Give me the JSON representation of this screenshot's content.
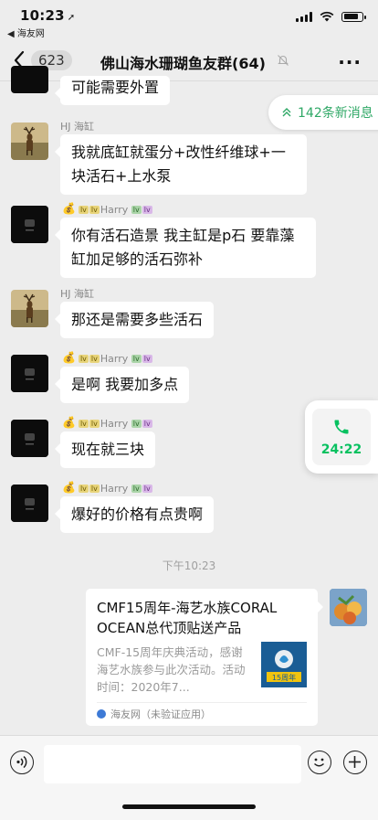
{
  "status_bar": {
    "time": "10:23",
    "back_app": "◀ 海友网"
  },
  "nav": {
    "unread_count": "623",
    "title": "佛山海水珊瑚鱼友群(64)"
  },
  "new_messages": "142条新消息",
  "messages": [
    {
      "sender": "",
      "text": "可能需要外置"
    },
    {
      "sender": "HJ 海缸",
      "text": "我就底缸就蛋分+改性纤维球+一块活石+上水泵"
    },
    {
      "sender": "Harry",
      "text": "你有活石造景  我主缸是p石 要靠藻缸加足够的活石弥补"
    },
    {
      "sender": "HJ 海缸",
      "text": "那还是需要多些活石"
    },
    {
      "sender": "Harry",
      "text": "是啊  我要加多点"
    },
    {
      "sender": "Harry",
      "text": "现在就三块"
    },
    {
      "sender": "Harry",
      "text": "爆好的价格有点贵啊"
    }
  ],
  "timestamp": "下午10:23",
  "call": {
    "duration": "24:22"
  },
  "link_card": {
    "title": "CMF15周年-海艺水族CORAL OCEAN总代顶贴送产品",
    "description": "CMF-15周年庆典活动，感谢海艺水族参与此次活动。活动时间：2020年7...",
    "source": "海友网（未验证应用）",
    "thumb_text": "15周年"
  },
  "icons": {
    "back": "chevron-left-icon",
    "mute": "mute-bell-icon",
    "more": "more-icon",
    "voice": "voice-icon",
    "emoji": "emoji-icon",
    "plus": "plus-icon",
    "phone": "phone-icon"
  },
  "colors": {
    "accent_green": "#07c160",
    "background": "#ededed"
  }
}
